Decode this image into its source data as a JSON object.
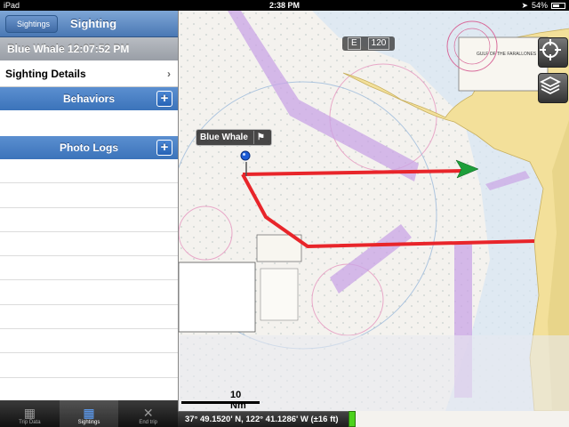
{
  "status_bar": {
    "device": "iPad",
    "time": "2:38 PM",
    "battery": "54%"
  },
  "nav": {
    "back_label": "Sightings",
    "title": "Sighting"
  },
  "sighting": {
    "header": "Blue Whale 12:07:52 PM",
    "details_label": "Sighting Details",
    "behaviors_label": "Behaviors",
    "photo_logs_label": "Photo Logs"
  },
  "tabs": [
    {
      "label": "Trip Data",
      "icon": "grid-icon"
    },
    {
      "label": "Sightings",
      "icon": "grid-icon"
    },
    {
      "label": "End trip",
      "icon": "close-icon"
    }
  ],
  "map": {
    "marker_label": "Blue Whale",
    "compass_heading": "E",
    "compass_value": "120",
    "scale_label": "10 Nm",
    "coordinates": "37° 49.1520' N, 122° 41.1286' W (±16 ft)",
    "chart_title_text": "GULF OF THE FARALLONES",
    "track_color": "#e8252a",
    "zone_color": "#c9a4e6",
    "land_color": "#f3e09a"
  }
}
